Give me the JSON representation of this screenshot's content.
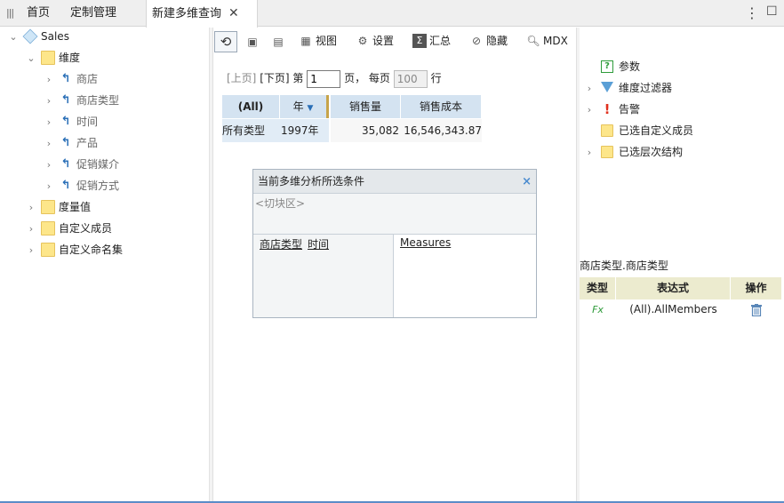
{
  "tabs": {
    "home": "首页",
    "custom": "定制管理",
    "active": "新建多维查询",
    "close": "✕"
  },
  "window": {
    "more": "⋮",
    "maximize": "☐"
  },
  "tree": {
    "root": "Sales",
    "dimension": "维度",
    "dims": [
      "商店",
      "商店类型",
      "时间",
      "产品",
      "促销媒介",
      "促销方式"
    ],
    "measures": "度量值",
    "custom_members": "自定义成员",
    "custom_sets": "自定义命名集"
  },
  "toolbar": {
    "view": "视图",
    "settings": "设置",
    "summary": "汇总",
    "hide": "隐藏",
    "mdx": "MDX"
  },
  "pager": {
    "prev": "[上页]",
    "next": "[下页]",
    "page_prefix": "第",
    "page_value": "1",
    "page_suffix": "页，",
    "per_page_prefix": "每页",
    "per_page_value": "100",
    "per_page_suffix": "行"
  },
  "grid": {
    "headers": [
      "(All)",
      "年",
      "销售量",
      "销售成本"
    ],
    "row": [
      "所有类型",
      "1997年",
      "35,082",
      "16,546,343.87"
    ]
  },
  "filter_panel": {
    "title": "当前多维分析所选条件",
    "close": "×",
    "slice_placeholder": "<切块区>",
    "rows": [
      "商店类型",
      "时间"
    ],
    "columns": [
      "Measures"
    ]
  },
  "right_panel": {
    "items": [
      "参数",
      "维度过滤器",
      "告警",
      "已选自定义成员",
      "已选层次结构"
    ],
    "expr_title": "商店类型.商店类型",
    "expr_headers": [
      "类型",
      "表达式",
      "操作"
    ],
    "expr_row": {
      "type_icon": "Fx",
      "expression": "(All).AllMembers",
      "action_icon": "trash-icon"
    }
  },
  "colors": {
    "accent": "#5b8cc7",
    "header_blue": "#d4e3f1",
    "expr_header": "#ecebcf"
  }
}
